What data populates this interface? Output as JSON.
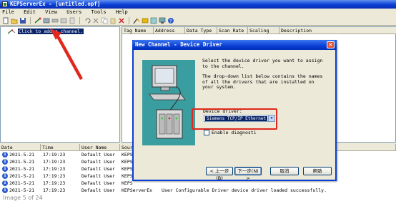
{
  "window": {
    "title": "KEPServerEx - [untitled.opf]"
  },
  "menu": [
    "File",
    "Edit",
    "View",
    "Users",
    "Tools",
    "Help"
  ],
  "tree": {
    "node_label": "Click to add a channel."
  },
  "list": {
    "columns": [
      "Tag Name",
      "Address",
      "Data Type",
      "Scan Rate",
      "Scaling",
      "Description"
    ]
  },
  "log": {
    "columns": [
      "Date",
      "Time",
      "User Name",
      "Source"
    ],
    "rows": [
      {
        "date": "2021-5-21",
        "time": "17:19:23",
        "user": "Default User",
        "source": "KEPS"
      },
      {
        "date": "2021-5-21",
        "time": "17:19:23",
        "user": "Default User",
        "source": "KEPS"
      },
      {
        "date": "2021-5-21",
        "time": "17:19:23",
        "user": "Default User",
        "source": "KEPS"
      },
      {
        "date": "2021-5-21",
        "time": "17:19:23",
        "user": "Default User",
        "source": "KEPS"
      },
      {
        "date": "2021-5-21",
        "time": "17:19:23",
        "user": "Default User",
        "source": "KEPS"
      },
      {
        "date": "2021-5-21",
        "time": "17:19:23",
        "user": "Default User",
        "source": "KEPServerEx",
        "message": "User Configurable Driver device driver loaded successfully."
      }
    ]
  },
  "caption": "Image 5 of 24",
  "dialog": {
    "title": "New Channel - Device Driver",
    "desc1": "Select the device driver you want to assign to the channel.",
    "desc2": "The drop-down list below contains the names of all the drivers that are installed on your system.",
    "driver_label": "Device driver:",
    "driver_value": "Siemens TCP/IP Ethernet",
    "diag_label": "Enable diagnosti",
    "buttons": {
      "back": "< 上一步(B)",
      "next": "下一步(N) >",
      "cancel": "取消",
      "help": "帮助"
    }
  },
  "colors": {
    "accent": "#0a3fd6",
    "annotation": "#e0281e",
    "selection": "#0a246a"
  }
}
